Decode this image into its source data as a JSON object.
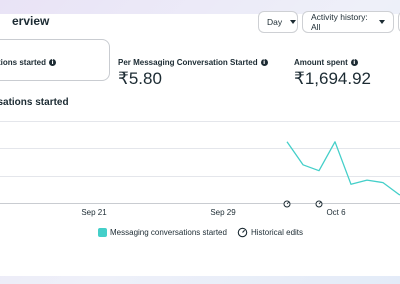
{
  "header": {
    "title": "erview",
    "day_select": "Day",
    "activity_select": "Activity history: All"
  },
  "metrics": [
    {
      "label": "rsations started",
      "value": ""
    },
    {
      "label": "Per Messaging Conversation Started",
      "value": "₹5.80"
    },
    {
      "label": "Amount spent",
      "value": "₹1,694.92"
    }
  ],
  "chart": {
    "title": "ersations started",
    "x_ticks": [
      "Sep 21",
      "Sep 29",
      "Oct 6"
    ],
    "legend": {
      "series": "Messaging conversations started",
      "edits": "Historical edits"
    },
    "colors": {
      "series": "#44cfc9"
    }
  },
  "chart_data": {
    "type": "line",
    "series": [
      {
        "name": "Messaging conversations started",
        "x": [
          "Oct 4",
          "Oct 5",
          "Oct 6",
          "Oct 7",
          "Oct 8",
          "Oct 9",
          "Oct 10",
          "Oct 11",
          "Oct 12",
          "Oct 13"
        ],
        "values": [
          0.72,
          0.45,
          0.38,
          0.72,
          0.22,
          0.27,
          0.24,
          0.1,
          0.05,
          0.02
        ]
      }
    ],
    "historical_edit_markers": [
      "Oct 4",
      "Oct 6"
    ],
    "ylim": [
      0,
      1
    ],
    "grid": true,
    "legend_position": "bottom"
  }
}
